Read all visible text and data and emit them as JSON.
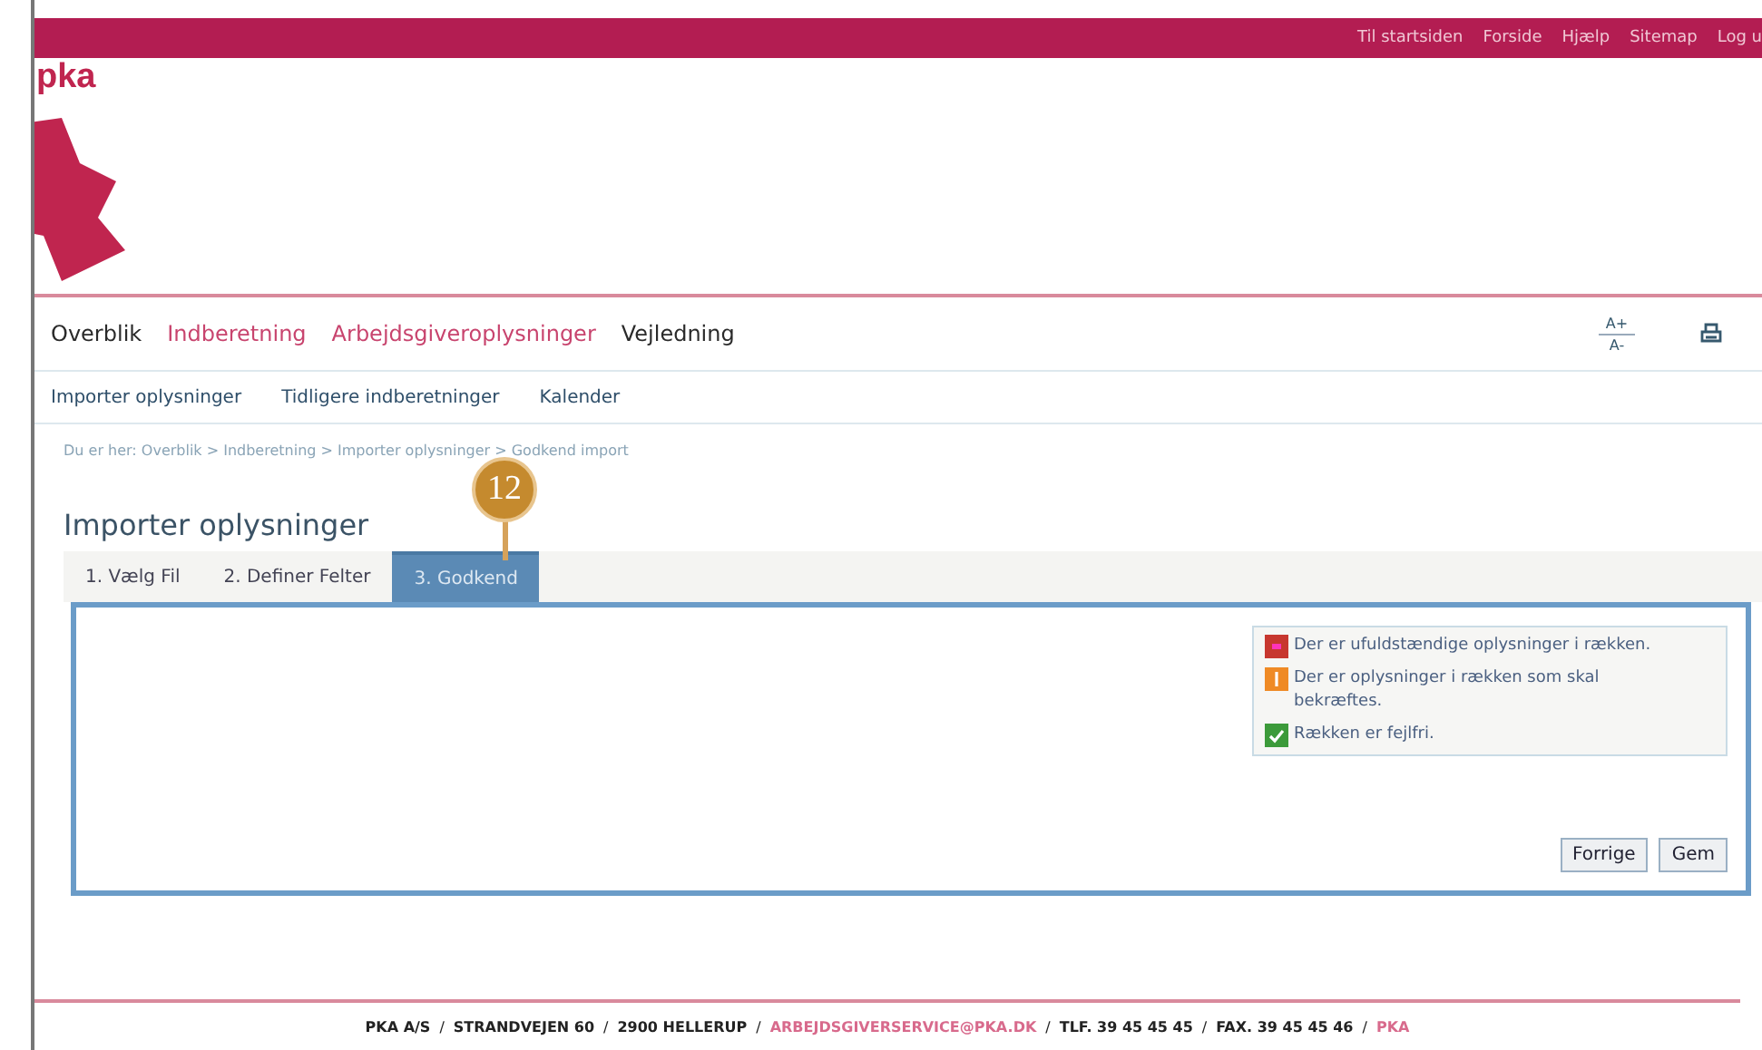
{
  "top_links": [
    "Til startsiden",
    "Forside",
    "Hjælp",
    "Sitemap",
    "Log u"
  ],
  "logo": {
    "text": "pka"
  },
  "main_nav": [
    {
      "label": "Overblik",
      "color": "#2a2a2a"
    },
    {
      "label": "Indberetning",
      "color": "#c8446e"
    },
    {
      "label": "Arbejdsgiveroplysninger",
      "color": "#c8446e"
    },
    {
      "label": "Vejledning",
      "color": "#2a2a2a"
    }
  ],
  "font_size": {
    "increase": "A+",
    "decrease": "A-"
  },
  "sub_nav": [
    "Importer oplysninger",
    "Tidligere indberetninger",
    "Kalender"
  ],
  "breadcrumb": "Du er her: Overblik > Indberetning > Importer oplysninger > Godkend import",
  "callout": "12",
  "heading": "Importer oplysninger",
  "tabs": [
    {
      "label": "1. Vælg Fil",
      "selected": false
    },
    {
      "label": "2. Definer Felter",
      "selected": false
    },
    {
      "label": "3. Godkend",
      "selected": true
    }
  ],
  "legend": [
    {
      "kind": "error",
      "text": "Der er ufuldstændige oplysninger i rækken."
    },
    {
      "kind": "warning",
      "text": "Der er oplysninger i rækken som skal bekræftes."
    },
    {
      "kind": "ok",
      "text": "Rækken er fejlfri."
    }
  ],
  "buttons": [
    "Forrige",
    "Gem"
  ],
  "footer": [
    {
      "kind": "text",
      "text": "PKA A/S"
    },
    {
      "kind": "separator",
      "text": "/"
    },
    {
      "kind": "text",
      "text": "STRANDVEJEN 60"
    },
    {
      "kind": "separator",
      "text": "/"
    },
    {
      "kind": "text",
      "text": "2900 HELLERUP"
    },
    {
      "kind": "separator",
      "text": "/"
    },
    {
      "kind": "link",
      "text": "ARBEJDSGIVERSERVICE@PKA.DK"
    },
    {
      "kind": "separator",
      "text": "/"
    },
    {
      "kind": "text",
      "text": "TLF. 39 45 45 45"
    },
    {
      "kind": "separator",
      "text": "/"
    },
    {
      "kind": "text",
      "text": "FAX. 39 45 45 46"
    },
    {
      "kind": "separator",
      "text": "/"
    },
    {
      "kind": "link",
      "text": "PKA"
    }
  ]
}
